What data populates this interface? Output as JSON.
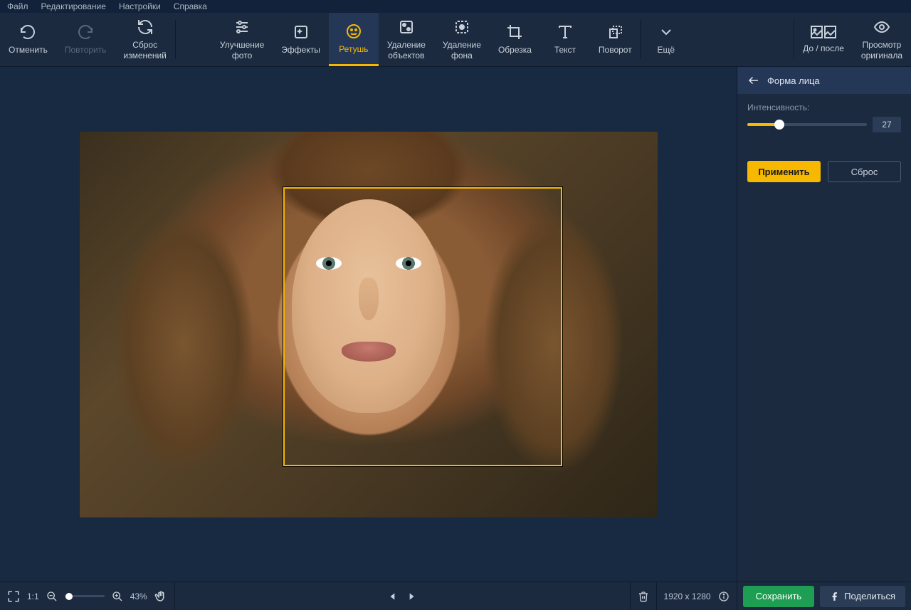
{
  "menu": {
    "items": [
      "Файл",
      "Редактирование",
      "Настройки",
      "Справка"
    ]
  },
  "toolbar": {
    "undo": "Отменить",
    "redo": "Повторить",
    "reset": "Сброс\nизменений",
    "enhance": "Улучшение\nфото",
    "effects": "Эффекты",
    "retouch": "Ретушь",
    "remove_objects": "Удаление\nобъектов",
    "remove_bg": "Удаление\nфона",
    "crop": "Обрезка",
    "text": "Текст",
    "rotate": "Поворот",
    "more": "Ещё",
    "before_after": "До / после",
    "view_original": "Просмотр\nоригинала"
  },
  "panel": {
    "title": "Форма лица",
    "intensity_label": "Интенсивность:",
    "intensity_value": "27",
    "intensity_pct": 27,
    "apply": "Применить",
    "reset": "Сброс"
  },
  "status": {
    "ratio": "1:1",
    "zoom": "43%",
    "dimensions": "1920 x 1280",
    "save": "Сохранить",
    "share": "Поделиться"
  }
}
